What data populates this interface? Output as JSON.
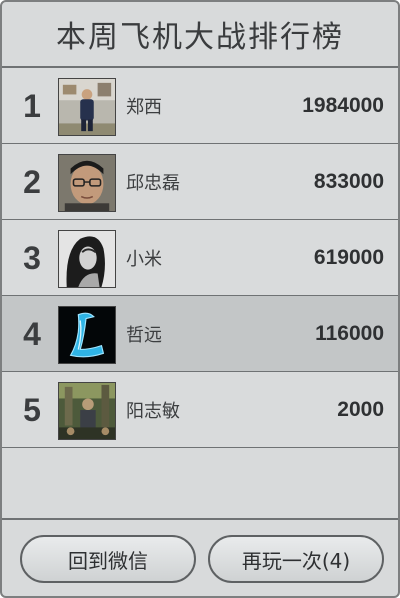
{
  "header": {
    "title": "本周飞机大战排行榜"
  },
  "leaderboard": [
    {
      "rank": "1",
      "name": "郑西",
      "score": "1984000",
      "avatar_icon": "avatar-person-photo-icon"
    },
    {
      "rank": "2",
      "name": "邱忠磊",
      "score": "833000",
      "avatar_icon": "avatar-glasses-photo-icon"
    },
    {
      "rank": "3",
      "name": "小米",
      "score": "619000",
      "avatar_icon": "avatar-woman-photo-icon"
    },
    {
      "rank": "4",
      "name": "哲远",
      "score": "116000",
      "avatar_icon": "avatar-letter-l-icon",
      "highlighted": true
    },
    {
      "rank": "5",
      "name": "阳志敏",
      "score": "2000",
      "avatar_icon": "avatar-game-scene-icon"
    }
  ],
  "buttons": {
    "back_label": "回到微信",
    "replay_label": "再玩一次(4)"
  },
  "colors": {
    "panel_bg": "#d8dadb",
    "highlight_row": "#c3c6c7",
    "border": "#6f7274",
    "text": "#3a3c3e"
  }
}
